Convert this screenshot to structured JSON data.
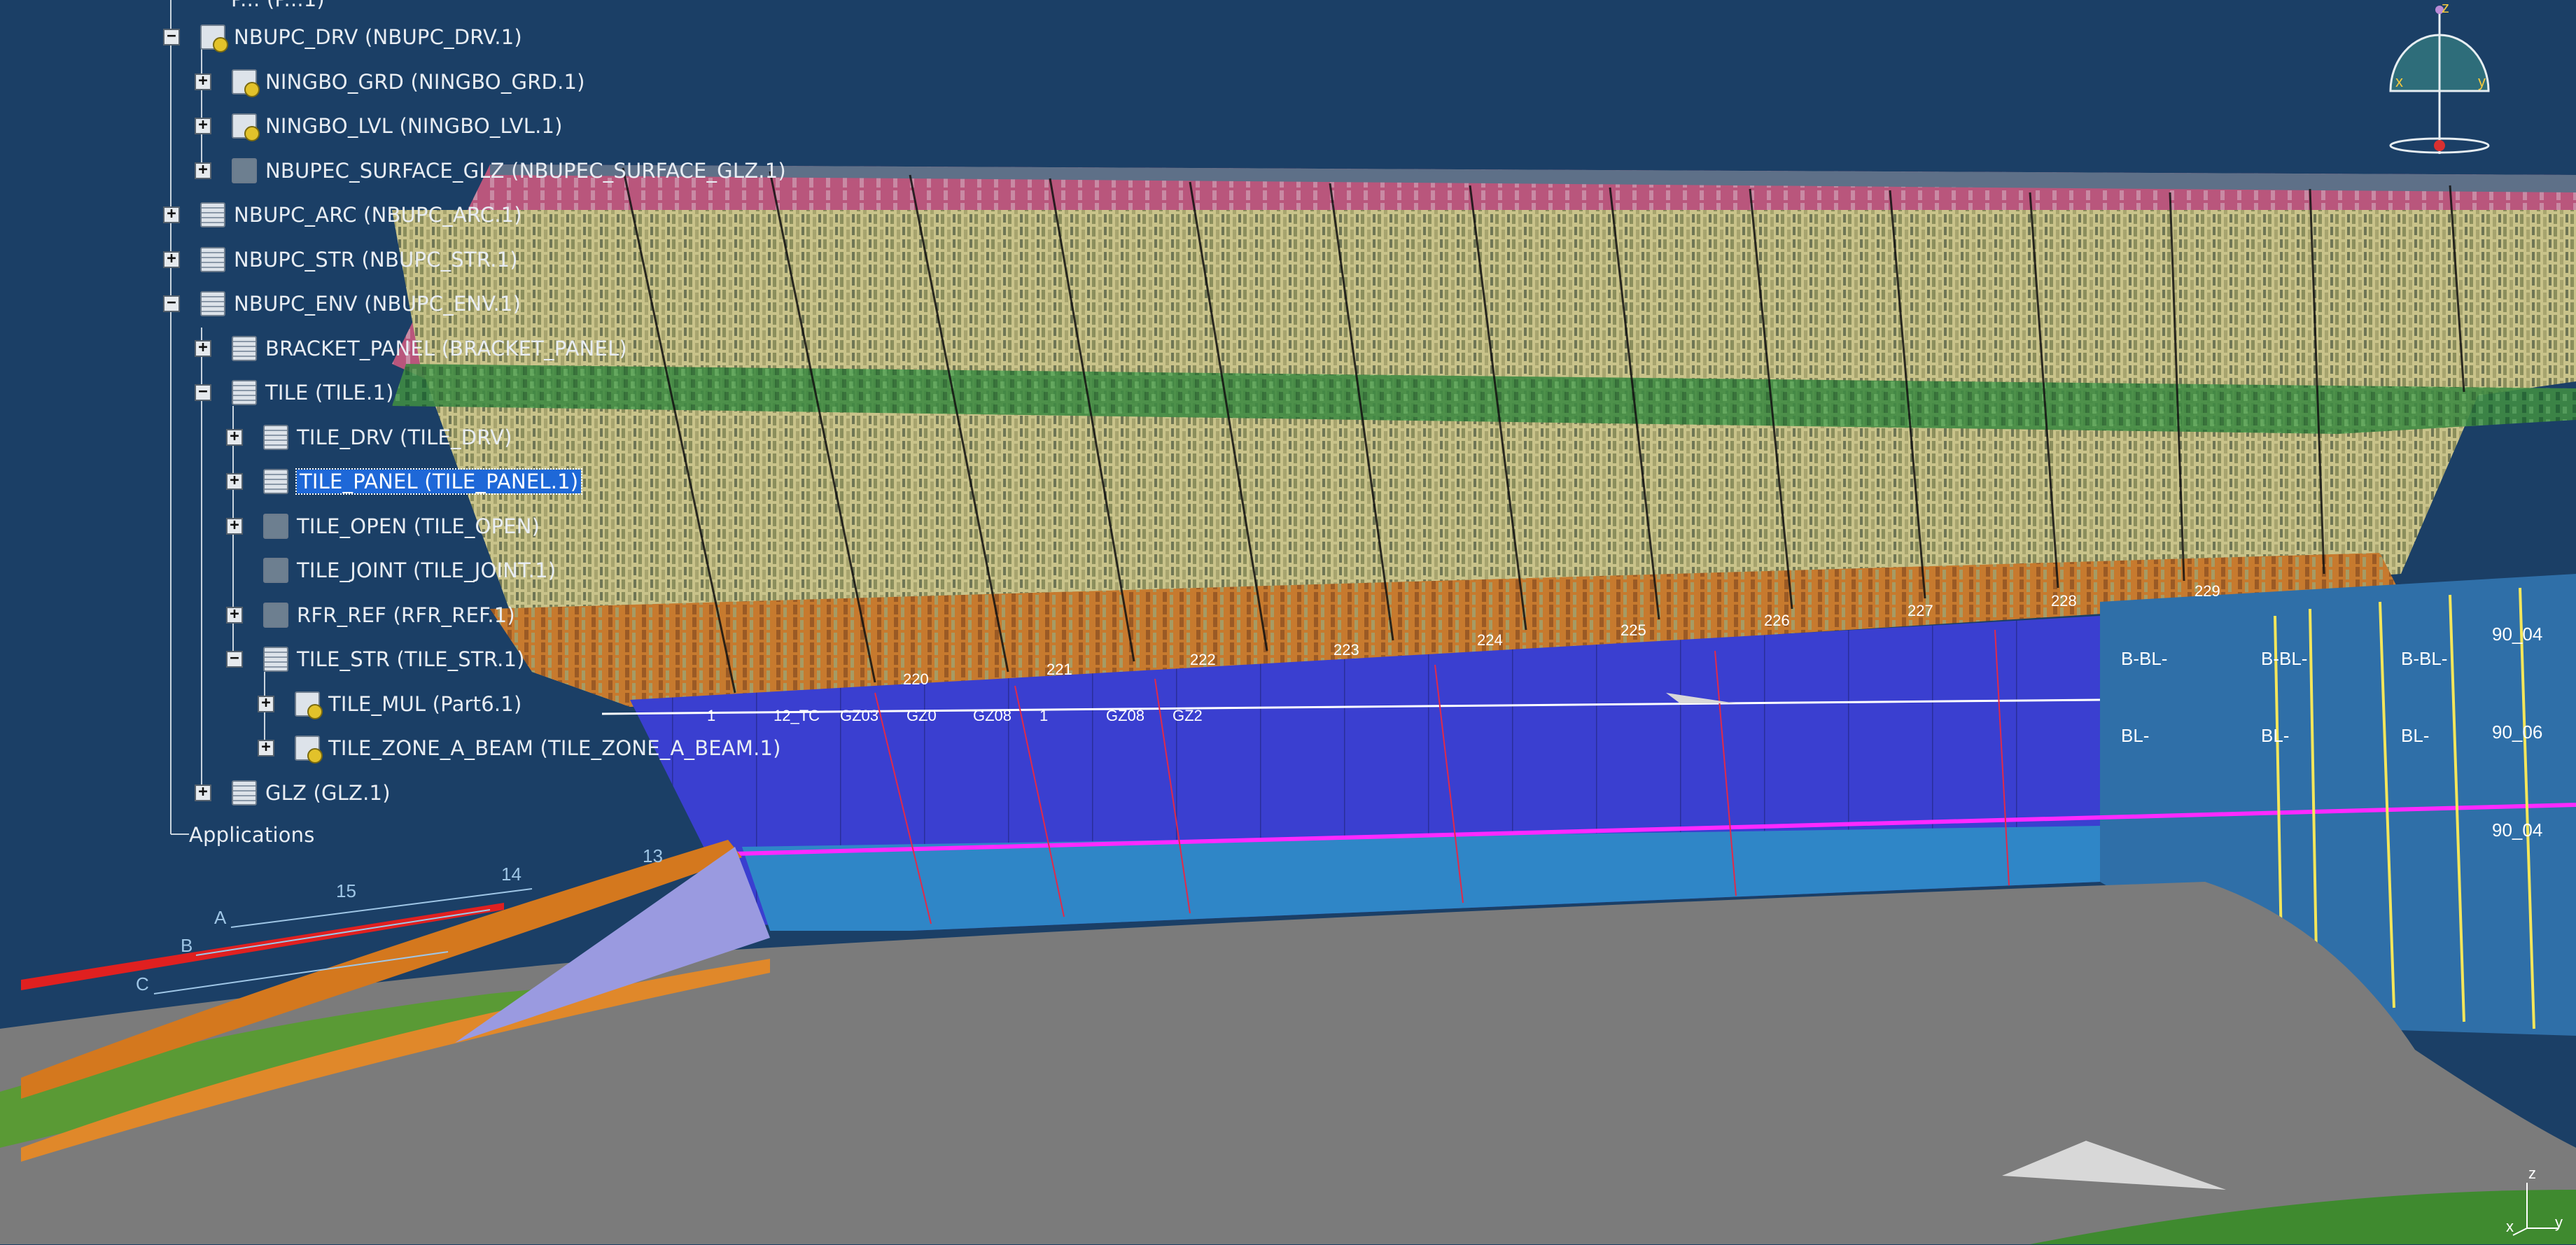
{
  "tree": {
    "partial_top": "P... (P...1)",
    "nodes": [
      {
        "label": "NBUPC_DRV (NBUPC_DRV.1)",
        "toggle": "−",
        "depth": 0,
        "icon": "part"
      },
      {
        "label": "NINGBO_GRD (NINGBO_GRD.1)",
        "toggle": "+",
        "depth": 1,
        "icon": "part"
      },
      {
        "label": "NINGBO_LVL (NINGBO_LVL.1)",
        "toggle": "+",
        "depth": 1,
        "icon": "part"
      },
      {
        "label": "NBUPEC_SURFACE_GLZ (NBUPEC_SURFACE_GLZ.1)",
        "toggle": "+",
        "depth": 1,
        "icon": "surf"
      },
      {
        "label": "NBUPC_ARC (NBUPC_ARC.1)",
        "toggle": "+",
        "depth": 0,
        "icon": "lines"
      },
      {
        "label": "NBUPC_STR (NBUPC_STR.1)",
        "toggle": "+",
        "depth": 0,
        "icon": "lines"
      },
      {
        "label": "NBUPC_ENV (NBUPC_ENV.1)",
        "toggle": "−",
        "depth": 0,
        "icon": "lines"
      },
      {
        "label": "BRACKET_PANEL (BRACKET_PANEL)",
        "toggle": "+",
        "depth": 1,
        "icon": "lines"
      },
      {
        "label": "TILE (TILE.1)",
        "toggle": "−",
        "depth": 1,
        "icon": "lines"
      },
      {
        "label": "TILE_DRV (TILE_DRV)",
        "toggle": "+",
        "depth": 2,
        "icon": "lines"
      },
      {
        "label": "TILE_PANEL (TILE_PANEL.1)",
        "toggle": "+",
        "depth": 2,
        "icon": "lines",
        "selected": true
      },
      {
        "label": "TILE_OPEN (TILE_OPEN)",
        "toggle": "+",
        "depth": 2,
        "icon": "surf"
      },
      {
        "label": "TILE_JOINT (TILE_JOINT.1)",
        "toggle": "",
        "depth": 2,
        "icon": "surf"
      },
      {
        "label": "RFR_REF (RFR_REF.1)",
        "toggle": "+",
        "depth": 2,
        "icon": "surf"
      },
      {
        "label": "TILE_STR (TILE_STR.1)",
        "toggle": "−",
        "depth": 2,
        "icon": "lines"
      },
      {
        "label": "TILE_MUL (Part6.1)",
        "toggle": "+",
        "depth": 3,
        "icon": "part"
      },
      {
        "label": "TILE_ZONE_A_BEAM (TILE_ZONE_A_BEAM.1)",
        "toggle": "+",
        "depth": 3,
        "icon": "part"
      },
      {
        "label": "GLZ (GLZ.1)",
        "toggle": "+",
        "depth": 1,
        "icon": "lines"
      }
    ],
    "applications_label": "Applications"
  },
  "grid_labels": [
    "220",
    "221",
    "222",
    "223",
    "224",
    "225",
    "226",
    "227",
    "228",
    "229"
  ],
  "grid_prefix": "2",
  "left_axis_labels": [
    "A",
    "B",
    "C"
  ],
  "left_numbers": [
    "15",
    "14",
    "13"
  ],
  "panel_tags": [
    "B-BL-",
    "B-BL-",
    "B-BL-",
    "BL-",
    "BL-",
    "BL-"
  ],
  "panel_tag_codes": [
    "90_04",
    "90_06",
    "90_04"
  ],
  "strip_codes": [
    "1",
    "12_TC",
    "GZ03",
    "GZ0",
    "GZ08",
    "1",
    "GZ08",
    "GZ2"
  ],
  "compass": {
    "z": "z",
    "x": "x",
    "y": "y"
  },
  "axis_small": {
    "z": "z",
    "x": "x",
    "y": "y"
  },
  "colors": {
    "background": "#1b3f66",
    "selection": "#1e68d8",
    "tile_yellow": "#c9c38a",
    "tile_green": "#3f8a43",
    "tile_pink": "#b9567c",
    "tile_orange": "#c77a2e",
    "glazing_blue": "#3a3fd0",
    "glazing_cyan": "#2f86c7",
    "roof_grey": "#7b7b7b",
    "orange_beam": "#d4781e",
    "magenta_line": "#ff29ff"
  }
}
